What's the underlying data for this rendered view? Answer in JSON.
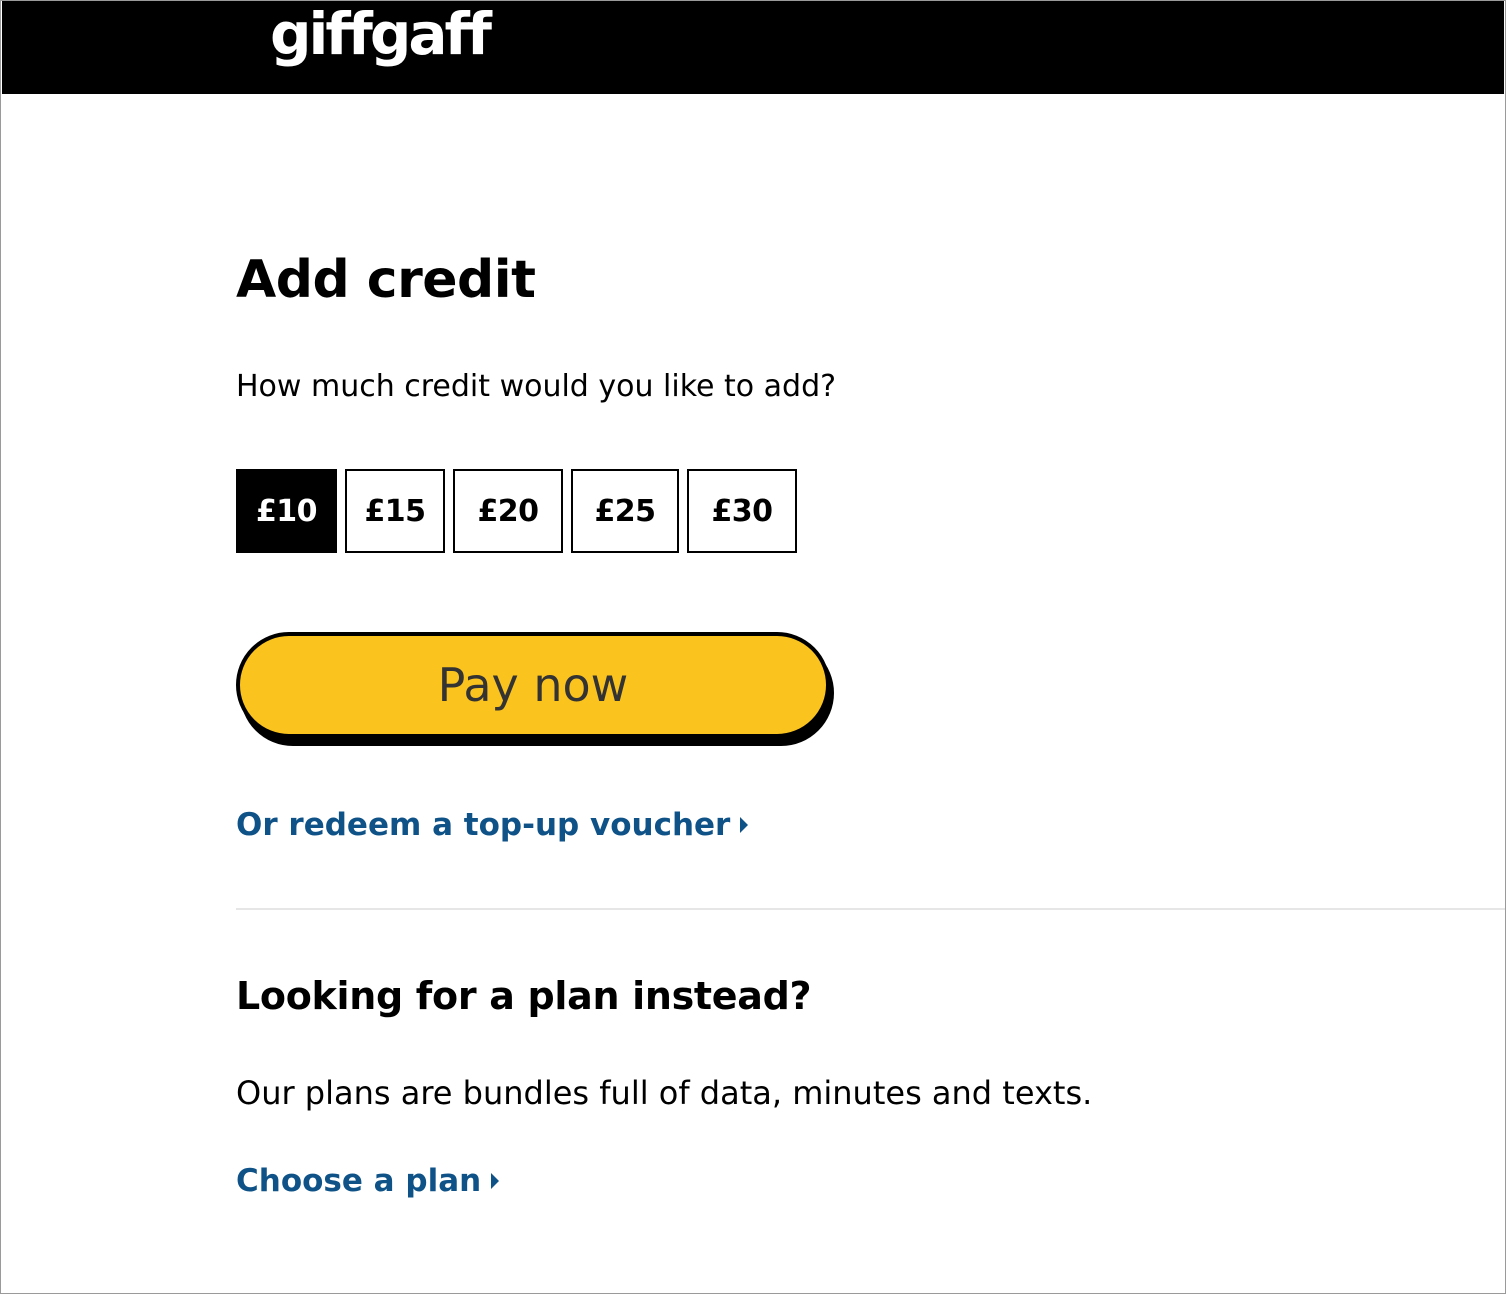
{
  "header": {
    "logo_text": "giffgaff"
  },
  "main": {
    "title": "Add credit",
    "question": "How much credit would you like to add?",
    "amounts": [
      "£10",
      "£15",
      "£20",
      "£25",
      "£30"
    ],
    "selected_amount": "£10",
    "pay_button_label": "Pay now",
    "voucher_link": "Or redeem a top-up voucher"
  },
  "plans": {
    "title": "Looking for a plan instead?",
    "description": "Our plans are bundles full of data, minutes and texts.",
    "link": "Choose a plan"
  },
  "colors": {
    "header_bg": "#000000",
    "pay_button_bg": "#fbc31e",
    "link_color": "#0e5287"
  }
}
